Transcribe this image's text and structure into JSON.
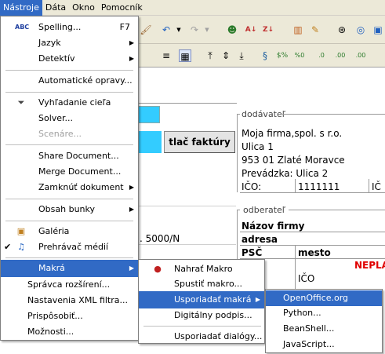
{
  "menubar": {
    "items": [
      {
        "label": "Nástroje"
      },
      {
        "label": "Dáta"
      },
      {
        "label": "Okno"
      },
      {
        "label": "Pomocník"
      }
    ]
  },
  "sheet": {
    "button_label": "tlač faktúry",
    "dodavatel_label": "dodávateľ",
    "dodavatel_lines": [
      "Moja firma,spol. s r.o.",
      "Ulica 1",
      "953 01 Zlaté Moravce",
      "Prevádzka: Ulica 2"
    ],
    "ico_label": "IČO:",
    "ico_value": "1111111",
    "ic_partial": "IČ",
    "odberatel_label": "odberateľ",
    "nazov_firmy": "Názov firmy",
    "adresa": "adresa",
    "psc": "PSČ",
    "mesto": "mesto",
    "nepla_partial": "NEPLA",
    "ico2": "IČO",
    "left_partial": ". 5000/N"
  },
  "menu": {
    "items": [
      {
        "label": "Spelling...",
        "shortcut": "F7",
        "icon": "spelling-icon"
      },
      {
        "label": "Jazyk",
        "submenu": true
      },
      {
        "label": "Detektív",
        "submenu": true
      },
      {
        "label": "Automatické opravy..."
      },
      {
        "label": "Vyhľadanie cieľa",
        "icon": "goal-seek-icon"
      },
      {
        "label": "Solver..."
      },
      {
        "label": "Scenáre...",
        "disabled": true
      },
      {
        "label": "Share Document..."
      },
      {
        "label": "Merge Document..."
      },
      {
        "label": "Zamknúť dokument",
        "submenu": true
      },
      {
        "label": "Obsah bunky",
        "submenu": true
      },
      {
        "label": "Galéria",
        "icon": "gallery-icon"
      },
      {
        "label": "Prehrávač médií",
        "icon": "media-player-icon",
        "checked": true
      },
      {
        "label": "Makrá",
        "submenu": true,
        "highlighted": true
      },
      {
        "label": "Správca rozšírení..."
      },
      {
        "label": "Nastavenia XML filtra..."
      },
      {
        "label": "Prispôsobiť..."
      },
      {
        "label": "Možnosti..."
      }
    ]
  },
  "submenu_makra": {
    "items": [
      {
        "label": "Nahrať Makro",
        "icon": "record-macro-icon"
      },
      {
        "label": "Spustiť makro..."
      },
      {
        "label": "Usporiadať makrá",
        "submenu": true,
        "highlighted": true
      },
      {
        "label": "Digitálny podpis..."
      },
      {
        "label": "Usporiadať dialógy..."
      }
    ]
  },
  "submenu_usporiadat": {
    "items": [
      {
        "label": "OpenOffice.org Basic...",
        "highlighted": true
      },
      {
        "label": "Python..."
      },
      {
        "label": "BeanShell..."
      },
      {
        "label": "JavaScript..."
      }
    ]
  }
}
